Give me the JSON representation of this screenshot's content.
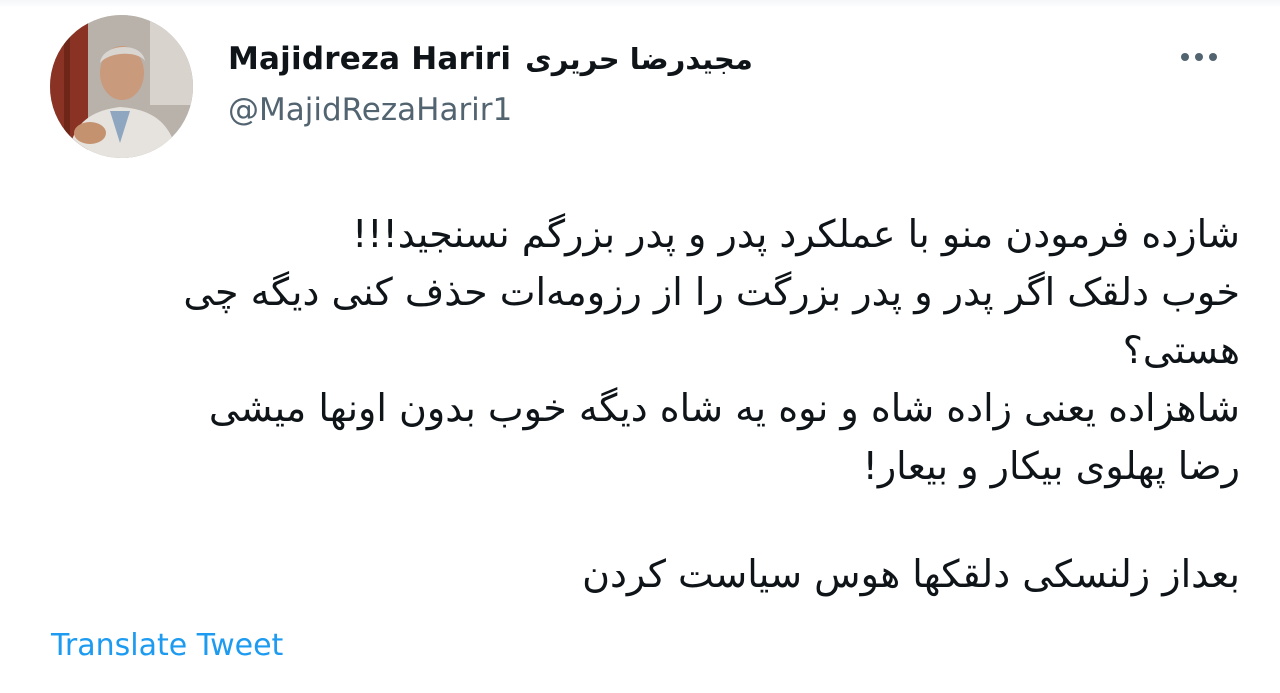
{
  "author": {
    "display_name_latin": "Majidreza Hariri",
    "display_name_persian": "مجیدرضا حریری",
    "handle": "@MajidRezaHarir1",
    "avatar_icon": "profile-photo"
  },
  "menu": {
    "more_icon": "more-horizontal-icon"
  },
  "tweet": {
    "lines": [
      "شازده فرمودن منو با عملکرد پدر و پدر بزرگم نسنجید!!!",
      "خوب دلقک اگر پدر و پدر بزرگت را از رزومه‌ات حذف کنی دیگه چی",
      "هستی؟",
      "شاهزاده یعنی زاده شاه و نوه یه شاه دیگه خوب بدون اونها میشی",
      "رضا پهلوی بیکار و بیعار!"
    ],
    "closing_line": "بعداز زلنسکی دلقکها هوس سیاست کردن"
  },
  "actions": {
    "translate_label": "Translate Tweet"
  },
  "colors": {
    "text_primary": "#0f1419",
    "text_secondary": "#536471",
    "link": "#1d9bf0",
    "background": "#ffffff"
  }
}
